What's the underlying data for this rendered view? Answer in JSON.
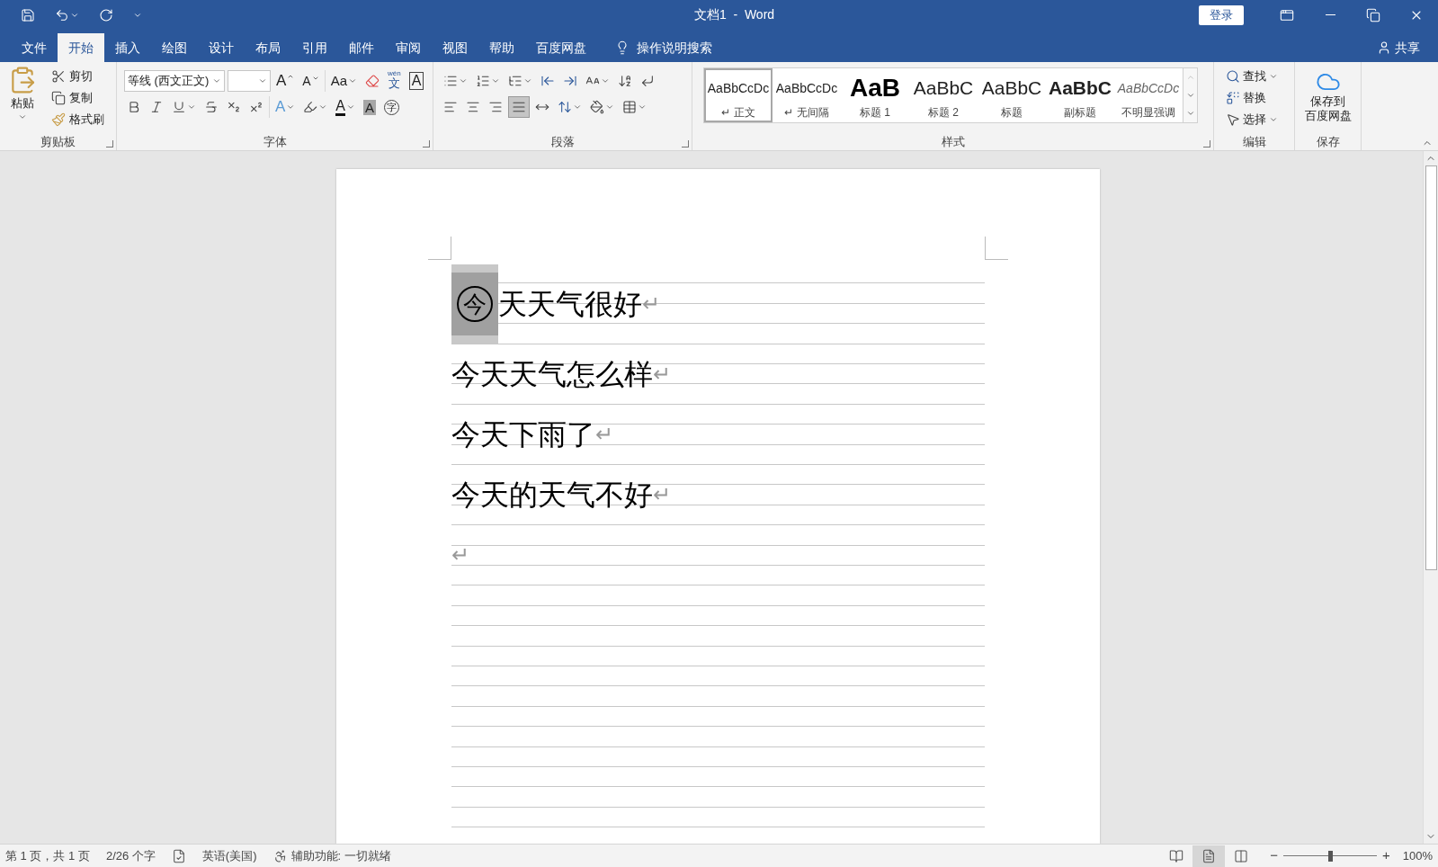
{
  "title_bar": {
    "title": "文档1  -  Word",
    "signin": "登录"
  },
  "tabs": [
    {
      "label": "文件",
      "selected": false
    },
    {
      "label": "开始",
      "selected": true
    },
    {
      "label": "插入",
      "selected": false
    },
    {
      "label": "绘图",
      "selected": false
    },
    {
      "label": "设计",
      "selected": false
    },
    {
      "label": "布局",
      "selected": false
    },
    {
      "label": "引用",
      "selected": false
    },
    {
      "label": "邮件",
      "selected": false
    },
    {
      "label": "审阅",
      "selected": false
    },
    {
      "label": "视图",
      "selected": false
    },
    {
      "label": "帮助",
      "selected": false
    },
    {
      "label": "百度网盘",
      "selected": false
    }
  ],
  "tell_me": "操作说明搜索",
  "share": "共享",
  "ribbon": {
    "clipboard": {
      "paste": "粘贴",
      "group": "剪贴板",
      "items": [
        {
          "kind": "cut",
          "label": "剪切"
        },
        {
          "kind": "copy",
          "label": "复制"
        },
        {
          "kind": "format_painter",
          "label": "格式刷"
        }
      ]
    },
    "font": {
      "group": "字体",
      "font_name": "等线 (西文正文)",
      "grow": "A",
      "shrink": "A",
      "change_case": "Aa",
      "phonetic_top": "wén",
      "phonetic": "文",
      "border_char": "A",
      "effects": "A",
      "font_color": "A",
      "shading_char": "A",
      "enclosed": "字"
    },
    "paragraph": {
      "group": "段落"
    },
    "styles": {
      "group": "样式",
      "items": [
        {
          "kind": "normal",
          "sample": "AaBbCcDc",
          "mark": "↵",
          "label": "正文",
          "selected": true
        },
        {
          "kind": "no_spacing",
          "sample": "AaBbCcDc",
          "mark": "↵",
          "label": "无间隔",
          "selected": false
        },
        {
          "kind": "heading1",
          "sample": "AaB",
          "label": "标题 1",
          "selected": false
        },
        {
          "kind": "heading2",
          "sample": "AaBbC",
          "label": "标题 2",
          "selected": false
        },
        {
          "kind": "title",
          "sample": "AaBbC",
          "label": "标题",
          "selected": false
        },
        {
          "kind": "subtitle",
          "sample": "AaBbC",
          "label": "副标题",
          "selected": false
        },
        {
          "kind": "subtle",
          "sample": "AaBbCcDc",
          "label": "不明显强调",
          "selected": false
        }
      ]
    },
    "editing": {
      "group": "编辑",
      "items": [
        {
          "kind": "find",
          "label": "查找"
        },
        {
          "kind": "replace",
          "label": "替换"
        },
        {
          "kind": "select",
          "label": "选择"
        }
      ]
    },
    "save": {
      "group": "保存",
      "lines": [
        "保存到",
        "百度网盘"
      ]
    }
  },
  "document": {
    "paragraphs": [
      {
        "enclosed": "今",
        "enclosed_selected": true,
        "text": "天天气很好",
        "mark": "↵"
      },
      {
        "text": "今天天气怎么样",
        "mark": "↵"
      },
      {
        "text": "今天下雨了",
        "mark": "↵"
      },
      {
        "text": "今天的天气不好",
        "mark": "↵"
      },
      {
        "mark": "↵"
      }
    ]
  },
  "status_bar": {
    "page": "第 1 页，共 1 页",
    "words": "2/26 个字",
    "language": "英语(美国)",
    "accessibility": "辅助功能: 一切就绪",
    "zoom_minus": "−",
    "zoom_plus": "+",
    "zoom": {
      "level": 0.5
    },
    "zoom_label": "100%"
  }
}
